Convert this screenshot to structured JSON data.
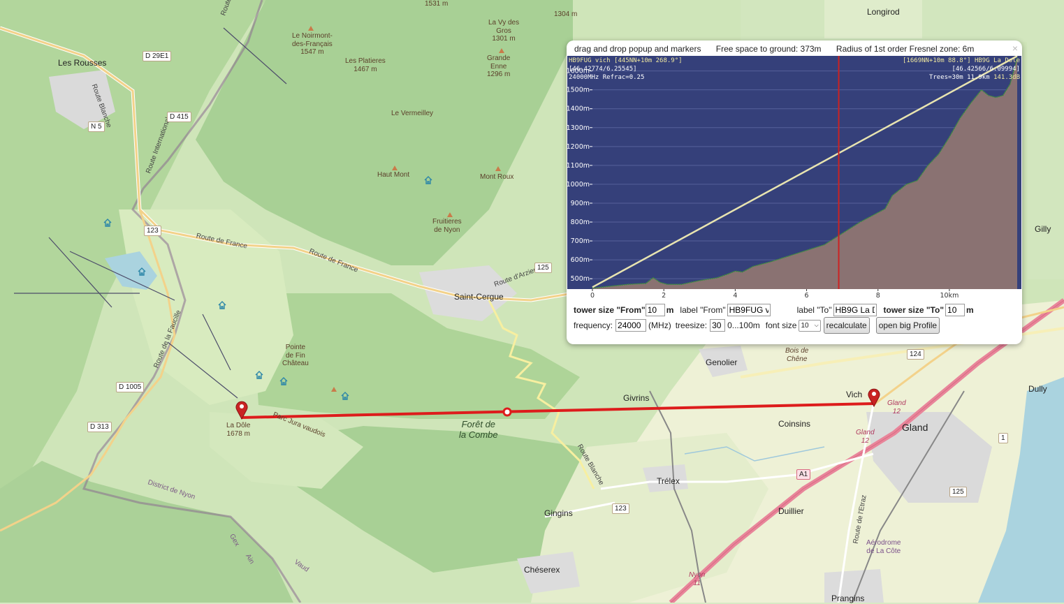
{
  "map": {
    "towns": [
      {
        "id": "les-rousses",
        "name": "Les Rousses"
      },
      {
        "id": "saint-cergue",
        "name": "Saint-Cergue"
      },
      {
        "id": "genolier",
        "name": "Genolier"
      },
      {
        "id": "givrins",
        "name": "Givrins"
      },
      {
        "id": "coinsins",
        "name": "Coinsins"
      },
      {
        "id": "vich",
        "name": "Vich"
      },
      {
        "id": "gland",
        "name": "Gland"
      },
      {
        "id": "trelex",
        "name": "Trélex"
      },
      {
        "id": "gingins",
        "name": "Gingins"
      },
      {
        "id": "duillier",
        "name": "Duillier"
      },
      {
        "id": "cheserex",
        "name": "Chéserex"
      },
      {
        "id": "prangins",
        "name": "Prangins"
      },
      {
        "id": "longirod",
        "name": "Longirod"
      },
      {
        "id": "gilly",
        "name": "Gilly"
      },
      {
        "id": "dully",
        "name": "Dully"
      }
    ],
    "peaks": {
      "noirmont": "Le Noirmont-\ndes-Français\n1547 m",
      "platieres": "Les Platieres\n1467 m",
      "vy_des_gros": "La Vy des\nGros\n1301 m",
      "grande_enne": "Grande\nEnne\n1296 m",
      "vermeilley": "Le Vermeilley",
      "haut_mont": "Haut Mont",
      "mont_roux": "Mont Roux",
      "fruitieres": "Fruitieres\nde Nyon",
      "pointe_fin_chateau": "Pointe\nde Fin\nChâteau",
      "la_dole": "La Dôle\n1678 m",
      "elev_1531": "1531 m",
      "elev_1304": "1304 m"
    },
    "areas": {
      "foret_combe": "Forêt de\nla Combe",
      "bois_chene": "Bois de\nChêne",
      "aerodrome": "Aérodrome\nde La Côte",
      "district_nyon": "District de Nyon",
      "gex": "Gex",
      "ain": "Ain",
      "vaud": "Vaud",
      "nyon": "Nyon\n11",
      "gland_12a": "Gland\n12",
      "gland_12b": "Gland\n12",
      "parc": "Parc Jura vaudois"
    },
    "road_labels": {
      "route_de_france": "Route de France",
      "route_de_france2": "Route de France",
      "route_blanche": "Route Blanche",
      "route_blanche2": "Route Blanche",
      "route_internationale": "Route Internationale",
      "route_faucille": "Route de la Faucille",
      "route_arzier": "Route d'Arzier",
      "route_etraz": "Route de l'Etraz",
      "route_top": "Route"
    },
    "shields": {
      "d29e1": "D 29E1",
      "d415": "D 415",
      "n5": "N 5",
      "r123a": "123",
      "r123b": "123",
      "r125a": "125",
      "r125b": "125",
      "r124": "124",
      "d1005": "D 1005",
      "d313": "D 313",
      "a1": "A1",
      "r1": "1"
    }
  },
  "popup": {
    "title": "drag and drop popup and markers",
    "free_space": "Free space to ground: 373m",
    "fresnel": "Radius of 1st order Fresnel zone: 6m",
    "close": "×",
    "profile_info": {
      "left_line1": "HB9FUG vich [445NN+10m 268.9°]",
      "left_line2": "[46.42774/6.25545]",
      "left_line3": "24000MHz Refrac=0.25",
      "right_line1": "[1669NN+10m 88.8°] HB9G La Dole",
      "right_line2": "[46.42566/6.09994]",
      "right_line3_prefix": "Trees=30m 11.9km ",
      "right_line3_db": "141.3dB"
    },
    "controls": {
      "tower_from_label": "tower size \"From\"",
      "tower_from_value": "10",
      "tower_from_unit": "m",
      "label_from_label": "label \"From\"",
      "label_from_value": "HB9FUG vi",
      "label_to_label": "label \"To\"",
      "label_to_value": "HB9G La D",
      "tower_to_label": "tower size \"To\"",
      "tower_to_value": "10",
      "tower_to_unit": "m",
      "frequency_label": "frequency:",
      "frequency_value": "24000",
      "frequency_unit": "(MHz)",
      "treesize_label": "treesize:",
      "treesize_value": "30",
      "treesize_range": "0...100m",
      "fontsize_label": "font size",
      "fontsize_value": "10",
      "recalculate": "recalculate",
      "open_big": "open big Profile"
    },
    "colors": {
      "sky": "#35407a",
      "terrain": "#8a7272",
      "terrain_edge": "#3c8f3c",
      "los": "#e8e4b0",
      "marker": "#cc2222"
    }
  },
  "chart_data": {
    "type": "area",
    "title": "",
    "xlabel": "",
    "ylabel": "",
    "x_ticks": [
      "0",
      "2",
      "4",
      "6",
      "8",
      "10km"
    ],
    "y_ticks": [
      "500m",
      "600m",
      "700m",
      "800m",
      "900m",
      "1000m",
      "1100m",
      "1200m",
      "1300m",
      "1400m",
      "1500m",
      "1600m"
    ],
    "xlim": [
      0,
      11.9
    ],
    "ylim": [
      445,
      1680
    ],
    "grid": true,
    "cursor_x_km": 6.9,
    "series": [
      {
        "x": [
          0,
          0.5,
          1,
          1.5,
          1.7,
          1.9,
          2.1,
          2.5,
          3,
          3.5,
          3.8,
          4,
          4.2,
          4.5,
          5,
          5.5,
          6,
          6.5,
          7,
          7.5,
          8,
          8.2,
          8.4,
          8.8,
          9.1,
          9.4,
          9.7,
          10,
          10.3,
          10.6,
          10.9,
          11.1,
          11.3,
          11.5,
          11.7,
          11.9
        ],
        "y": [
          450,
          460,
          470,
          475,
          505,
          480,
          470,
          470,
          490,
          505,
          525,
          540,
          535,
          565,
          590,
          620,
          650,
          680,
          740,
          800,
          850,
          870,
          940,
          1000,
          1020,
          1100,
          1160,
          1250,
          1350,
          1430,
          1500,
          1470,
          1460,
          1470,
          1530,
          1669
        ]
      },
      {
        "x": [
          0,
          11.9
        ],
        "y": [
          455,
          1679
        ]
      }
    ]
  }
}
